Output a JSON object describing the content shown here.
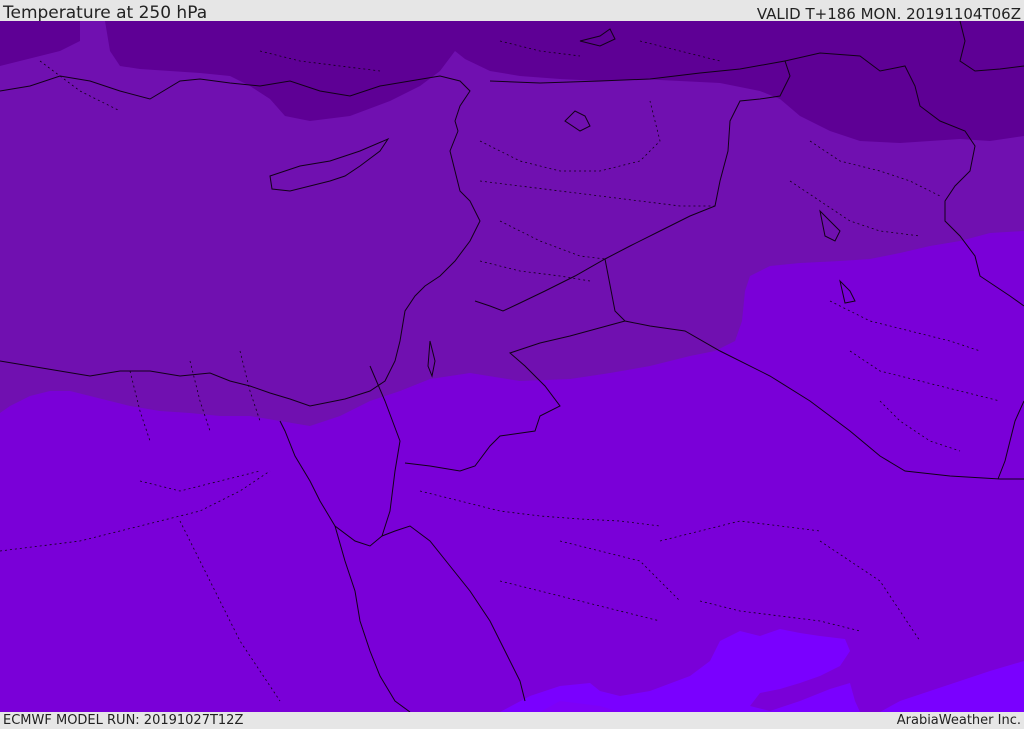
{
  "header": {
    "title": "Temperature at 250 hPa",
    "valid": "VALID T+186 MON. 20191104T06Z"
  },
  "footer": {
    "model_run": "ECMWF MODEL RUN: 20191027T12Z",
    "credit": "ArabiaWeather Inc."
  },
  "map": {
    "colors": {
      "coldest": "#5e0095",
      "cold": "#7010b0",
      "mid": "#7a00d8",
      "warm": "#8000f0",
      "warmest": "#7a00ff"
    }
  }
}
